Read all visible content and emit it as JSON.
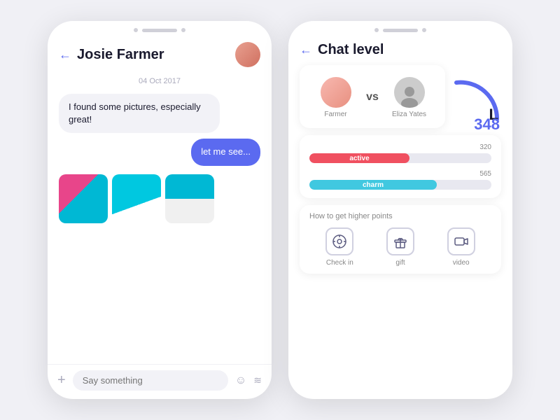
{
  "left_phone": {
    "header": {
      "back_label": "←",
      "title": "Josie Farmer",
      "avatar_alt": "Josie avatar"
    },
    "date_label": "04 Oct 2017",
    "messages": [
      {
        "text": "I found some pictures, especially great!",
        "type": "received"
      },
      {
        "text": "let me see...",
        "type": "sent"
      }
    ],
    "input_placeholder": "Say something"
  },
  "right_phone": {
    "header": {
      "back_label": "←",
      "title": "Chat level"
    },
    "vs": {
      "player1_name": "Farmer",
      "player2_name": "Eliza Yates",
      "vs_label": "vs"
    },
    "stats": [
      {
        "label": "active",
        "value": 320,
        "type": "active"
      },
      {
        "label": "charm",
        "value": 565,
        "type": "charm"
      }
    ],
    "level": {
      "letter": "L",
      "number": "348"
    },
    "tips": {
      "title": "How to get higher points",
      "items": [
        {
          "label": "Check in",
          "icon": "⊙"
        },
        {
          "label": "gift",
          "icon": "🎁"
        },
        {
          "label": "video",
          "icon": "📹"
        }
      ]
    }
  },
  "colors": {
    "accent": "#5b6af0",
    "active_bar": "#f05060",
    "charm_bar": "#40c8e0",
    "received_bg": "#f2f2f7",
    "sent_bg": "#5b6af0"
  }
}
